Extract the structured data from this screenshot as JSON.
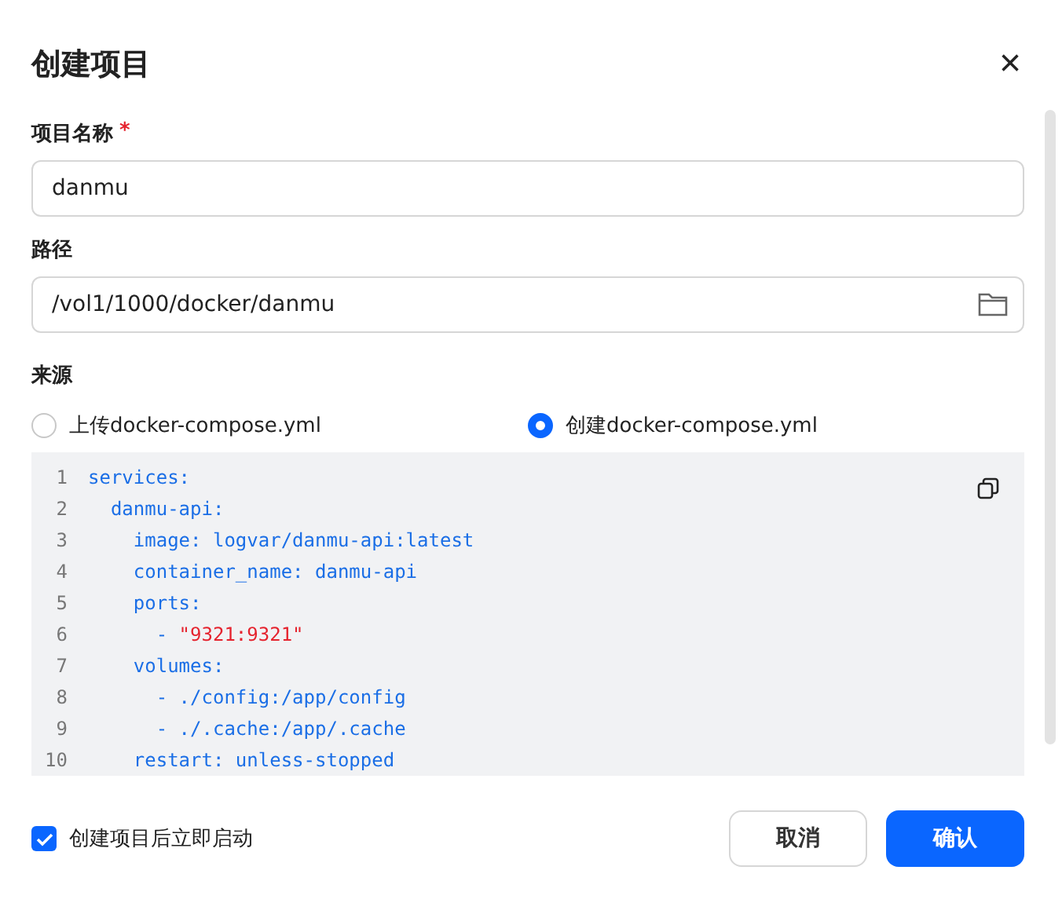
{
  "dialog": {
    "title": "创建项目",
    "close": "×"
  },
  "fields": [
    {
      "kind": "text",
      "label": "项目名称",
      "required_mark": "*",
      "value": "danmu"
    },
    {
      "kind": "path",
      "label": "路径",
      "value": "/vol1/1000/docker/danmu"
    }
  ],
  "source": {
    "label": "来源",
    "options": [
      {
        "label": "上传docker-compose.yml",
        "selected": false
      },
      {
        "label": "创建docker-compose.yml",
        "selected": true
      }
    ]
  },
  "editor": {
    "lines": [
      {
        "number": "1",
        "segments": [
          {
            "kind": "code",
            "text": "services:"
          }
        ]
      },
      {
        "number": "2",
        "segments": [
          {
            "kind": "code",
            "text": "  danmu-api:"
          }
        ]
      },
      {
        "number": "3",
        "segments": [
          {
            "kind": "code",
            "text": "    image: logvar/danmu-api:latest"
          }
        ]
      },
      {
        "number": "4",
        "segments": [
          {
            "kind": "code",
            "text": "    container_name: danmu-api"
          }
        ]
      },
      {
        "number": "5",
        "segments": [
          {
            "kind": "code",
            "text": "    ports:"
          }
        ]
      },
      {
        "number": "6",
        "segments": [
          {
            "kind": "code",
            "text": "      - "
          },
          {
            "kind": "string",
            "text": "\"9321:9321\""
          }
        ]
      },
      {
        "number": "7",
        "segments": [
          {
            "kind": "code",
            "text": "    volumes:"
          }
        ]
      },
      {
        "number": "8",
        "segments": [
          {
            "kind": "code",
            "text": "      - ./config:/app/config"
          }
        ]
      },
      {
        "number": "9",
        "segments": [
          {
            "kind": "code",
            "text": "      - ./.cache:/app/.cache"
          }
        ]
      },
      {
        "number": "10",
        "segments": [
          {
            "kind": "code",
            "text": "    restart: unless-stopped"
          }
        ]
      }
    ]
  },
  "footer": {
    "start_after_create": {
      "label": "创建项目后立即启动",
      "checked": true
    },
    "buttons": [
      {
        "kind": "secondary",
        "label": "取消"
      },
      {
        "kind": "primary",
        "label": "确认"
      }
    ]
  }
}
